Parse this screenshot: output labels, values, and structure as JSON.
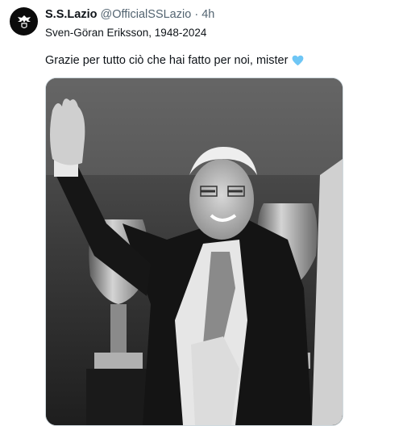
{
  "account": {
    "display_name": "S.S.Lazio",
    "handle": "@OfficialSSLazio",
    "separator": "·",
    "time": "4h",
    "avatar_icon": "lazio-eagle-logo-icon"
  },
  "tweet": {
    "subtitle": "Sven-Göran Eriksson, 1948-2024",
    "text": "Grazie per tutto ciò che hai fatto per noi, mister",
    "emoji_icon": "light-blue-heart-icon",
    "emoji_color": "#6ec6f5"
  },
  "media": {
    "type": "black-and-white photo",
    "subject": "smiling man with glasses in suit raising hand, trophies in background"
  },
  "colors": {
    "text_primary": "#0f1419",
    "text_secondary": "#536471"
  }
}
